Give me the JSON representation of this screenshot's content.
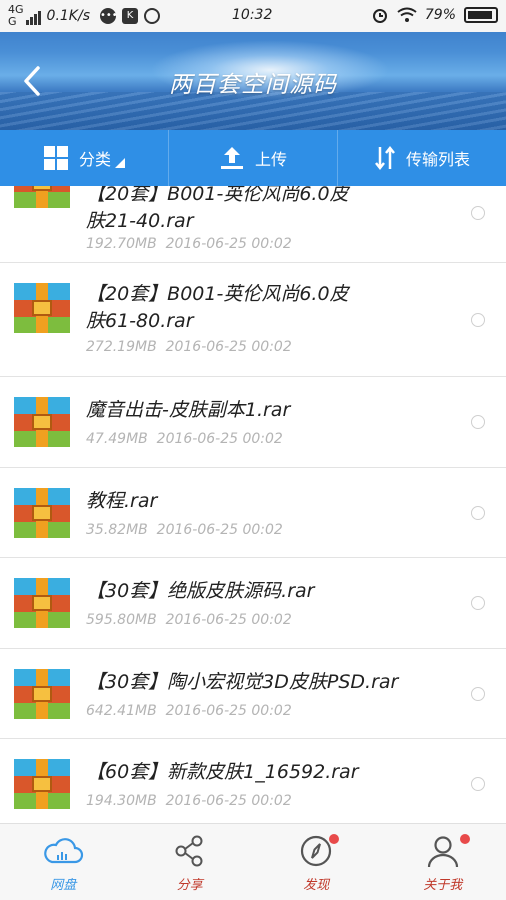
{
  "status_bar": {
    "network_top": "4G",
    "network_bottom": "G",
    "speed": "0.1K/s",
    "time": "10:32",
    "battery_pct": "79%"
  },
  "header": {
    "title": "两百套空间源码",
    "back_icon": "chevron-left-icon"
  },
  "toolbar": {
    "items": [
      {
        "label": "分类",
        "icon": "grid-icon"
      },
      {
        "label": "上传",
        "icon": "upload-icon"
      },
      {
        "label": "传输列表",
        "icon": "transfer-icon"
      }
    ]
  },
  "files": [
    {
      "name": "【20套】B001-英伦风尚6.0皮肤21-40.rar",
      "name_line1": "【20套】B001-英伦风尚6.0皮",
      "name_line2": "肤21-40.rar",
      "size": "192.70MB",
      "date": "2016-06-25 00:02"
    },
    {
      "name": "【20套】B001-英伦风尚6.0皮肤61-80.rar",
      "name_line1": "【20套】B001-英伦风尚6.0皮",
      "name_line2": "肤61-80.rar",
      "size": "272.19MB",
      "date": "2016-06-25 00:02"
    },
    {
      "name": "魔音出击-皮肤副本1.rar",
      "size": "47.49MB",
      "date": "2016-06-25 00:02"
    },
    {
      "name": "教程.rar",
      "size": "35.82MB",
      "date": "2016-06-25 00:02"
    },
    {
      "name": "【30套】绝版皮肤源码.rar",
      "size": "595.80MB",
      "date": "2016-06-25 00:02"
    },
    {
      "name": "【30套】陶小宏视觉3D皮肤PSD.rar",
      "size": "642.41MB",
      "date": "2016-06-25 00:02"
    },
    {
      "name": "【60套】新款皮肤1_16592.rar",
      "size": "194.30MB",
      "date": "2016-06-25 00:02"
    }
  ],
  "bottom_nav": [
    {
      "label": "网盘",
      "icon": "cloud-icon",
      "active": true
    },
    {
      "label": "分享",
      "icon": "share-icon"
    },
    {
      "label": "发现",
      "icon": "compass-icon",
      "badge": true
    },
    {
      "label": "关于我",
      "icon": "user-icon",
      "badge": true
    }
  ],
  "colors": {
    "toolbar": "#2f8fe6",
    "active_nav": "#3a98e6",
    "badge": "#e84a4a"
  }
}
